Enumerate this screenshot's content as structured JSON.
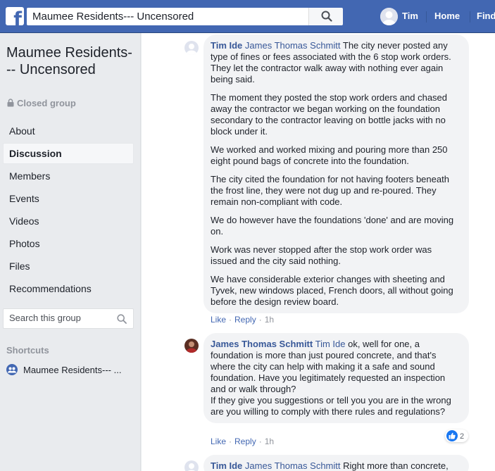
{
  "topbar": {
    "logo_icon": "facebook-f-icon",
    "search_value": "Maumee Residents--- Uncensored",
    "user_name": "Tim",
    "nav_home": "Home",
    "nav_find": "Find"
  },
  "sidebar": {
    "group_title": "Maumee Residents--- Uncensored",
    "privacy": "Closed group",
    "items": [
      {
        "label": "About",
        "active": false
      },
      {
        "label": "Discussion",
        "active": true
      },
      {
        "label": "Members",
        "active": false
      },
      {
        "label": "Events",
        "active": false
      },
      {
        "label": "Videos",
        "active": false
      },
      {
        "label": "Photos",
        "active": false
      },
      {
        "label": "Files",
        "active": false
      },
      {
        "label": "Recommendations",
        "active": false
      }
    ],
    "search_placeholder": "Search this group",
    "shortcuts_title": "Shortcuts",
    "shortcut_label": "Maumee Residents--- ..."
  },
  "comments": [
    {
      "author": "Tim Ide",
      "mention": "James Thomas Schmitt",
      "paragraphs": [
        "The city never posted any type of fines or fees associated with the 6 stop work orders. They let the contractor walk away with nothing ever again being said.",
        "The moment they posted the stop work orders and chased away the contractor we began working on the foundation secondary to the contractor leaving on bottle jacks with no block under it.",
        "We worked and worked mixing and pouring more than 250 eight pound bags of concrete into the foundation.",
        "The city cited the foundation for not having footers beneath the frost line, they were not dug up and re-poured. They remain non-compliant with code.",
        "We do however have the foundations 'done' and are moving on.",
        "Work was never stopped after the stop work order was issued and the city said nothing.",
        "We have considerable exterior changes with sheeting and Tyvek, new windows placed, French doors, all without going before the design review board."
      ],
      "like": "Like",
      "reply": "Reply",
      "time": "1h"
    },
    {
      "author": "James Thomas Schmitt",
      "mention": "Tim Ide",
      "text": "ok, well for one, a foundation is more than just poured concrete, and that's where the city can help with making it a safe and sound foundation. Have you legitimately requested an inspection and or walk through?\nIf they give you suggestions or tell you you are in the wrong are you willing to comply with there rules and regulations?",
      "reactions": "2",
      "like": "Like",
      "reply": "Reply",
      "time": "1h"
    },
    {
      "author": "Tim Ide",
      "mention": "James Thomas Schmitt",
      "text": "Right more than concrete,"
    }
  ]
}
